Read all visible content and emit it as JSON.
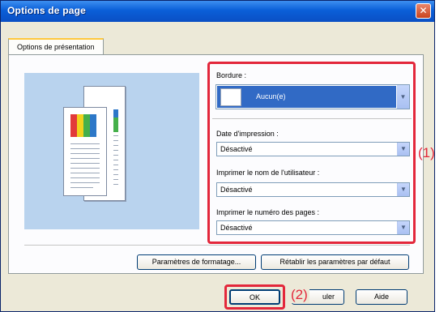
{
  "window": {
    "title": "Options de page",
    "close_glyph": "✕"
  },
  "tabs": [
    {
      "label": "Options de présentation"
    }
  ],
  "fields": {
    "bordure": {
      "label": "Bordure :",
      "value": "Aucun(e)"
    },
    "date": {
      "label": "Date d'impression :",
      "value": "Désactivé"
    },
    "user": {
      "label": "Imprimer le nom de l'utilisateur :",
      "value": "Désactivé"
    },
    "pages": {
      "label": "Imprimer le numéro des pages :",
      "value": "Désactivé"
    }
  },
  "buttons": {
    "formatting": "Paramètres de formatage...",
    "reset": "Rétablir les paramètres par défaut",
    "ok": "OK",
    "cancel_partial": "uler",
    "help": "Aide"
  },
  "annotations": {
    "callout1": "(1)",
    "callout2": "(2)"
  },
  "colors": {
    "highlight": "#e3273b",
    "selection": "#316ac5",
    "titlebar": "#0a5fd8"
  },
  "icons": {
    "dropdown": "chevron-down-icon",
    "close": "close-icon"
  }
}
